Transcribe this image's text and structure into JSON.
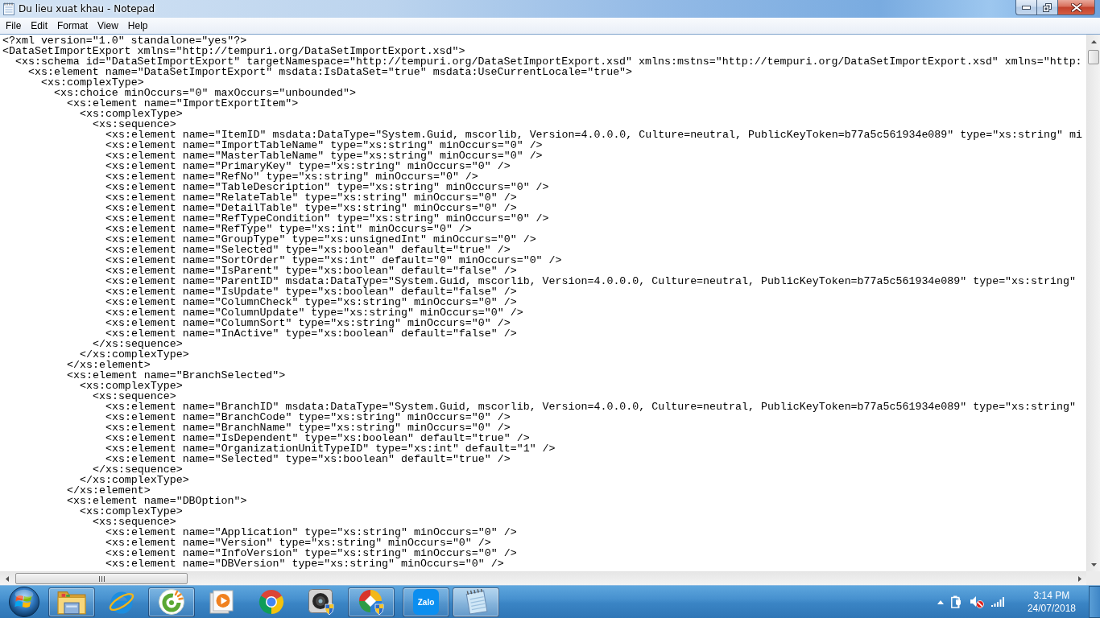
{
  "window": {
    "title": "Du lieu xuat khau - Notepad",
    "maximized": true
  },
  "menu": [
    "File",
    "Edit",
    "Format",
    "View",
    "Help"
  ],
  "document": {
    "lines": [
      {
        "text": "<?xml version=\"1.0\" standalone=\"yes\"?>"
      },
      {
        "text": "<DataSetImportExport xmlns=\"http://tempuri.org/DataSetImportExport.xsd\">",
        "children": [
          {
            "text": "<xs:schema id=\"DataSetImportExport\" targetNamespace=\"http://tempuri.org/DataSetImportExport.xsd\" xmlns:mstns=\"http://tempuri.org/DataSetImportExport.xsd\" xmlns=\"http:",
            "children": [
              {
                "text": "<xs:element name=\"DataSetImportExport\" msdata:IsDataSet=\"true\" msdata:UseCurrentLocale=\"true\">",
                "children": [
                  {
                    "text": "<xs:complexType>",
                    "children": [
                      {
                        "text": "<xs:choice minOccurs=\"0\" maxOccurs=\"unbounded\">",
                        "children": [
                          {
                            "text": "<xs:element name=\"ImportExportItem\">",
                            "children": [
                              {
                                "text": "<xs:complexType>",
                                "children": [
                                  {
                                    "text": "<xs:sequence>",
                                    "children": [
                                      {
                                        "text": "<xs:element name=\"ItemID\" msdata:DataType=\"System.Guid, mscorlib, Version=4.0.0.0, Culture=neutral, PublicKeyToken=b77a5c561934e089\" type=\"xs:string\" mi"
                                      },
                                      {
                                        "text": "<xs:element name=\"ImportTableName\" type=\"xs:string\" minOccurs=\"0\" />"
                                      },
                                      {
                                        "text": "<xs:element name=\"MasterTableName\" type=\"xs:string\" minOccurs=\"0\" />"
                                      },
                                      {
                                        "text": "<xs:element name=\"PrimaryKey\" type=\"xs:string\" minOccurs=\"0\" />"
                                      },
                                      {
                                        "text": "<xs:element name=\"RefNo\" type=\"xs:string\" minOccurs=\"0\" />"
                                      },
                                      {
                                        "text": "<xs:element name=\"TableDescription\" type=\"xs:string\" minOccurs=\"0\" />"
                                      },
                                      {
                                        "text": "<xs:element name=\"RelateTable\" type=\"xs:string\" minOccurs=\"0\" />"
                                      },
                                      {
                                        "text": "<xs:element name=\"DetailTable\" type=\"xs:string\" minOccurs=\"0\" />"
                                      },
                                      {
                                        "text": "<xs:element name=\"RefTypeCondition\" type=\"xs:string\" minOccurs=\"0\" />"
                                      },
                                      {
                                        "text": "<xs:element name=\"RefType\" type=\"xs:int\" minOccurs=\"0\" />"
                                      },
                                      {
                                        "text": "<xs:element name=\"GroupType\" type=\"xs:unsignedInt\" minOccurs=\"0\" />"
                                      },
                                      {
                                        "text": "<xs:element name=\"Selected\" type=\"xs:boolean\" default=\"true\" />"
                                      },
                                      {
                                        "text": "<xs:element name=\"SortOrder\" type=\"xs:int\" default=\"0\" minOccurs=\"0\" />"
                                      },
                                      {
                                        "text": "<xs:element name=\"IsParent\" type=\"xs:boolean\" default=\"false\" />"
                                      },
                                      {
                                        "text": "<xs:element name=\"ParentID\" msdata:DataType=\"System.Guid, mscorlib, Version=4.0.0.0, Culture=neutral, PublicKeyToken=b77a5c561934e089\" type=\"xs:string\""
                                      },
                                      {
                                        "text": "<xs:element name=\"IsUpdate\" type=\"xs:boolean\" default=\"false\" />"
                                      },
                                      {
                                        "text": "<xs:element name=\"ColumnCheck\" type=\"xs:string\" minOccurs=\"0\" />"
                                      },
                                      {
                                        "text": "<xs:element name=\"ColumnUpdate\" type=\"xs:string\" minOccurs=\"0\" />"
                                      },
                                      {
                                        "text": "<xs:element name=\"ColumnSort\" type=\"xs:string\" minOccurs=\"0\" />"
                                      },
                                      {
                                        "text": "<xs:element name=\"InActive\" type=\"xs:boolean\" default=\"false\" />"
                                      }
                                    ],
                                    "close": "</xs:sequence>"
                                  }
                                ],
                                "close": "</xs:complexType>"
                              }
                            ],
                            "close": "</xs:element>"
                          },
                          {
                            "text": "<xs:element name=\"BranchSelected\">",
                            "children": [
                              {
                                "text": "<xs:complexType>",
                                "children": [
                                  {
                                    "text": "<xs:sequence>",
                                    "children": [
                                      {
                                        "text": "<xs:element name=\"BranchID\" msdata:DataType=\"System.Guid, mscorlib, Version=4.0.0.0, Culture=neutral, PublicKeyToken=b77a5c561934e089\" type=\"xs:string\""
                                      },
                                      {
                                        "text": "<xs:element name=\"BranchCode\" type=\"xs:string\" minOccurs=\"0\" />"
                                      },
                                      {
                                        "text": "<xs:element name=\"BranchName\" type=\"xs:string\" minOccurs=\"0\" />"
                                      },
                                      {
                                        "text": "<xs:element name=\"IsDependent\" type=\"xs:boolean\" default=\"true\" />"
                                      },
                                      {
                                        "text": "<xs:element name=\"OrganizationUnitTypeID\" type=\"xs:int\" default=\"1\" />"
                                      },
                                      {
                                        "text": "<xs:element name=\"Selected\" type=\"xs:boolean\" default=\"true\" />"
                                      }
                                    ],
                                    "close": "</xs:sequence>"
                                  }
                                ],
                                "close": "</xs:complexType>"
                              }
                            ],
                            "close": "</xs:element>"
                          },
                          {
                            "text": "<xs:element name=\"DBOption\">",
                            "children": [
                              {
                                "text": "<xs:complexType>",
                                "children": [
                                  {
                                    "text": "<xs:sequence>",
                                    "children": [
                                      {
                                        "text": "<xs:element name=\"Application\" type=\"xs:string\" minOccurs=\"0\" />"
                                      },
                                      {
                                        "text": "<xs:element name=\"Version\" type=\"xs:string\" minOccurs=\"0\" />"
                                      },
                                      {
                                        "text": "<xs:element name=\"InfoVersion\" type=\"xs:string\" minOccurs=\"0\" />"
                                      },
                                      {
                                        "text": "<xs:element name=\"DBVersion\" type=\"xs:string\" minOccurs=\"0\" />"
                                      }
                                    ]
                                  }
                                ]
                              }
                            ]
                          }
                        ]
                      }
                    ]
                  }
                ]
              }
            ]
          }
        ]
      }
    ]
  },
  "taskbar": {
    "apps": [
      {
        "kind": "folder",
        "running": true,
        "selected": false
      },
      {
        "kind": "orbit",
        "running": false,
        "selected": false
      },
      {
        "kind": "ring",
        "running": true,
        "selected": false
      },
      {
        "kind": "player",
        "running": false,
        "selected": false
      },
      {
        "kind": "segmented",
        "running": false,
        "selected": false
      },
      {
        "kind": "camera",
        "running": false,
        "selected": false
      },
      {
        "kind": "diamond",
        "running": true,
        "selected": false
      },
      {
        "kind": "chat",
        "label": "Zalo",
        "running": true,
        "selected": false
      },
      {
        "kind": "notepad",
        "running": true,
        "selected": true
      }
    ],
    "tray": {
      "muted": true
    },
    "clock": {
      "time": "3:14 PM",
      "date": "24/07/2018"
    }
  }
}
